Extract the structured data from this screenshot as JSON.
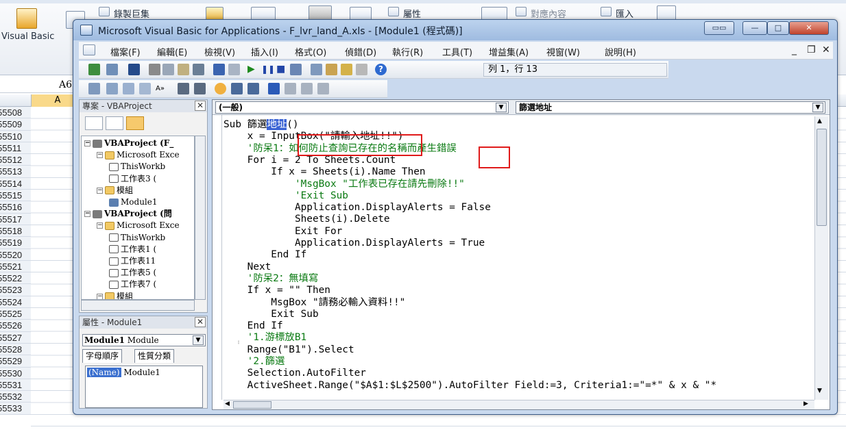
{
  "excel": {
    "ribbon_items": [
      "錄製巨集",
      "屬性",
      "對應內容",
      "匯入"
    ],
    "vb_label": "Visual Basic",
    "name_box": "A6",
    "col_header": "A",
    "row_numbers": [
      "55508",
      "55509",
      "55510",
      "55511",
      "55512",
      "55513",
      "55514",
      "55515",
      "55516",
      "55517",
      "55518",
      "55519",
      "55520",
      "55521",
      "55522",
      "55523",
      "55524",
      "55525",
      "55526",
      "55527",
      "55528",
      "55529",
      "55530",
      "55531",
      "55532",
      "55533"
    ]
  },
  "vbe": {
    "title": "Microsoft Visual Basic for Applications - F_lvr_land_A.xls - [Module1 (程式碼)]",
    "menu": [
      "檔案(F)",
      "編輯(E)",
      "檢視(V)",
      "插入(I)",
      "格式(O)",
      "偵錯(D)",
      "執行(R)",
      "工具(T)",
      "增益集(A)",
      "視窗(W)",
      "說明(H)"
    ],
    "mdi_controls": [
      "_",
      "❐",
      "✕"
    ],
    "position": "列 1，行 13",
    "project_pane": {
      "title": "專案 - VBAProject",
      "tree": [
        {
          "label": "VBAProject (F_",
          "expand": "−",
          "icon": "project-icon",
          "bold": true
        },
        {
          "label": "Microsoft Exce",
          "expand": "−",
          "icon": "folder-icon",
          "bold": false
        },
        {
          "label": "ThisWorkb",
          "expand": "",
          "icon": "workbook-icon",
          "bold": false
        },
        {
          "label": "工作表3 (",
          "expand": "",
          "icon": "sheet-icon",
          "bold": false
        },
        {
          "label": "模組",
          "expand": "−",
          "icon": "folder-icon",
          "bold": false
        },
        {
          "label": "Module1",
          "expand": "",
          "icon": "module-icon",
          "bold": false
        },
        {
          "label": "VBAProject (問",
          "expand": "−",
          "icon": "project-icon",
          "bold": true
        },
        {
          "label": "Microsoft Exce",
          "expand": "−",
          "icon": "folder-icon",
          "bold": false
        },
        {
          "label": "ThisWorkb",
          "expand": "",
          "icon": "workbook-icon",
          "bold": false
        },
        {
          "label": "工作表1 (",
          "expand": "",
          "icon": "sheet-icon",
          "bold": false
        },
        {
          "label": "工作表11",
          "expand": "",
          "icon": "sheet-icon",
          "bold": false
        },
        {
          "label": "工作表5 (",
          "expand": "",
          "icon": "sheet-icon",
          "bold": false
        },
        {
          "label": "工作表7 (",
          "expand": "",
          "icon": "sheet-icon",
          "bold": false
        },
        {
          "label": "模組",
          "expand": "−",
          "icon": "folder-icon",
          "bold": false
        }
      ]
    },
    "props_pane": {
      "title": "屬性 - Module1",
      "object_name": "Module1",
      "object_type": "Module",
      "tab_alpha": "字母順序",
      "tab_category": "性質分類",
      "prop_key": "(Name)",
      "prop_value": "Module1"
    },
    "code": {
      "object_combo": "(一般)",
      "proc_combo": "篩選地址",
      "lines": [
        {
          "a": "Sub 篩選",
          "b": "地址",
          "c": "()",
          "type": "code"
        },
        {
          "a": "    x = InputBox(\"請輸入地址!!\")",
          "b": "",
          "c": "",
          "type": "code"
        },
        {
          "a": "    '防呆1：如何防止查詢已存在的名稱而產生錯誤",
          "b": "",
          "c": "",
          "type": "comment"
        },
        {
          "a": "    For i = 2 To Sheets.Count",
          "b": "",
          "c": "",
          "type": "code"
        },
        {
          "a": "        If x = Sheets(i).Name Then",
          "b": "",
          "c": "",
          "type": "code"
        },
        {
          "a": "            'MsgBox \"工作表已存在請先刪除!!\"",
          "b": "",
          "c": "",
          "type": "comment"
        },
        {
          "a": "            'Exit Sub",
          "b": "",
          "c": "",
          "type": "comment"
        },
        {
          "a": "            Application.DisplayAlerts = False",
          "b": "",
          "c": "",
          "type": "code"
        },
        {
          "a": "            Sheets(i).Delete",
          "b": "",
          "c": "",
          "type": "code"
        },
        {
          "a": "            Exit For",
          "b": "",
          "c": "",
          "type": "code"
        },
        {
          "a": "            Application.DisplayAlerts = True",
          "b": "",
          "c": "",
          "type": "code"
        },
        {
          "a": "        End If",
          "b": "",
          "c": "",
          "type": "code"
        },
        {
          "a": "    Next",
          "b": "",
          "c": "",
          "type": "code"
        },
        {
          "a": "    '防呆2：無填寫",
          "b": "",
          "c": "",
          "type": "comment"
        },
        {
          "a": "    If x = \"\" Then",
          "b": "",
          "c": "",
          "type": "code"
        },
        {
          "a": "        MsgBox \"請務必輸入資料!!\"",
          "b": "",
          "c": "",
          "type": "code"
        },
        {
          "a": "        Exit Sub",
          "b": "",
          "c": "",
          "type": "code"
        },
        {
          "a": "    End If",
          "b": "",
          "c": "",
          "type": "code"
        },
        {
          "a": "    '1.游標放B1",
          "b": "",
          "c": "",
          "type": "comment"
        },
        {
          "a": "    Range(\"B1\").Select",
          "b": "",
          "c": "",
          "type": "code"
        },
        {
          "a": "    '2.篩選",
          "b": "",
          "c": "",
          "type": "comment"
        },
        {
          "a": "    Selection.AutoFilter",
          "b": "",
          "c": "",
          "type": "code"
        },
        {
          "a": "    ActiveSheet.Range(\"$A$1:$L$2500\").AutoFilter Field:=3, Criteria1:=\"=*\" & x & \"*",
          "b": "",
          "c": "",
          "type": "code"
        }
      ]
    },
    "highlight_color": "#e01a1a",
    "selection_color": "#3a63d4"
  }
}
